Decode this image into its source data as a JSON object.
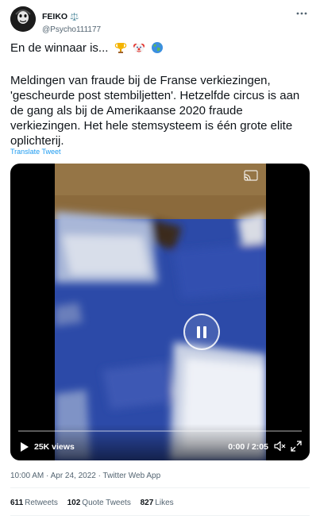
{
  "author": {
    "display_name": "FEIKO",
    "name_emoji": "⚖️",
    "handle": "@Psycho111177"
  },
  "tweet": {
    "headline": "En de winnaar is...",
    "headline_emojis": [
      "trophy-emoji",
      "clown-face-emoji",
      "globe-emoji"
    ],
    "body": "Meldingen van fraude bij de Franse verkiezingen, 'gescheurde post stembiljetten'. Hetzelfde circus is aan de gang als bij de Amerikaanse 2020 fraude verkiezingen. Het hele stemsysteem is één grote elite oplichterij.",
    "translate_label": "Translate Tweet"
  },
  "video": {
    "views": "25K views",
    "time": "0:00 / 2:05",
    "progress_fraction": 0,
    "state": "playing",
    "icons": [
      "cast-icon",
      "pause-icon",
      "play-icon",
      "volume-icon",
      "fullscreen-icon"
    ]
  },
  "meta": {
    "timestamp": "10:00 AM · Apr 24, 2022 · Twitter Web App"
  },
  "stats": [
    {
      "count": "611",
      "label": "Retweets"
    },
    {
      "count": "102",
      "label": "Quote Tweets"
    },
    {
      "count": "827",
      "label": "Likes"
    }
  ],
  "colors": {
    "link": "#1d9bf0",
    "text_primary": "#0f1419",
    "text_secondary": "#536471"
  }
}
